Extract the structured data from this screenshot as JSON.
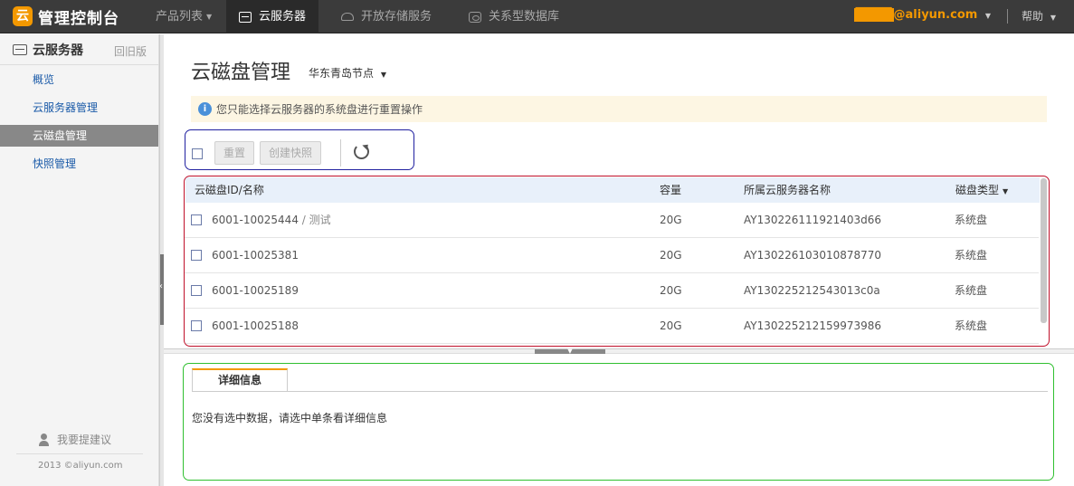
{
  "topbar": {
    "logo_text": "管理控制台",
    "nav": [
      {
        "label": "产品列表",
        "icon": "caret-down-icon"
      },
      {
        "label": "云服务器",
        "icon": "server-icon"
      },
      {
        "label": "开放存储服务",
        "icon": "cloud-storage-icon"
      },
      {
        "label": "关系型数据库",
        "icon": "database-icon"
      }
    ],
    "user_email_masked": "████",
    "user_email_domain": "@aliyun.com",
    "help": "帮助"
  },
  "sidebar": {
    "title": "云服务器",
    "old_version": "回旧版",
    "items": [
      {
        "label": "概览",
        "active": false
      },
      {
        "label": "云服务器管理",
        "active": false
      },
      {
        "label": "云磁盘管理",
        "active": true
      },
      {
        "label": "快照管理",
        "active": false
      }
    ],
    "feedback": "我要提建议",
    "copyright": "2013 ©aliyun.com"
  },
  "main": {
    "title": "云磁盘管理",
    "region": "华东青岛节点",
    "notice": "您只能选择云服务器的系统盘进行重置操作",
    "toolbar": {
      "reset_label": "重置",
      "snapshot_label": "创建快照"
    },
    "table": {
      "columns": [
        "云磁盘ID/名称",
        "容量",
        "所属云服务器名称",
        "磁盘类型"
      ],
      "rows": [
        {
          "id": "6001-10025444",
          "name": "测试",
          "capacity": "20G",
          "server": "AY130226111921403d66",
          "type": "系统盘"
        },
        {
          "id": "6001-10025381",
          "name": "",
          "capacity": "20G",
          "server": "AY130226103010878770",
          "type": "系统盘"
        },
        {
          "id": "6001-10025189",
          "name": "",
          "capacity": "20G",
          "server": "AY130225212543013c0a",
          "type": "系统盘"
        },
        {
          "id": "6001-10025188",
          "name": "",
          "capacity": "20G",
          "server": "AY130225212159973986",
          "type": "系统盘"
        }
      ]
    },
    "detail": {
      "tab_label": "详细信息",
      "empty_text": "您没有选中数据，请选中单条看详细信息"
    }
  },
  "colors": {
    "accent": "#f39800",
    "topbar": "#3b3b3b",
    "link": "#1a5aa8",
    "toolbar_outline": "#2020a0",
    "table_outline": "#c0102a",
    "detail_outline": "#30c030"
  }
}
